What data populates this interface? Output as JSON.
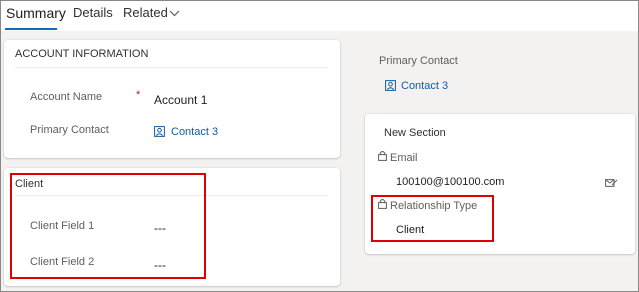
{
  "tabs": [
    {
      "label": "Summary"
    },
    {
      "label": "Details"
    },
    {
      "label": "Related"
    }
  ],
  "account_info": {
    "title": "ACCOUNT INFORMATION",
    "fields": [
      {
        "label": "Account Name",
        "required": "*",
        "value": "Account 1"
      },
      {
        "label": "Primary Contact",
        "value": "Contact 3"
      }
    ]
  },
  "client_section": {
    "title": "Client",
    "fields": [
      {
        "label": "Client Field 1",
        "value": "---"
      },
      {
        "label": "Client Field 2",
        "value": "---"
      }
    ]
  },
  "right_top": {
    "label": "Primary Contact",
    "value": "Contact 3"
  },
  "new_section": {
    "title": "New Section",
    "email_label": "Email",
    "email_value": "100100@100100.com",
    "relationship_label": "Relationship Type",
    "relationship_value": "Client"
  },
  "colors": {
    "accent": "#0f6cbd",
    "link": "#115ea3",
    "required": "#a4262c",
    "highlight": "#e00000"
  },
  "icons": [
    "chevron-down-icon",
    "contact-card-icon",
    "lock-icon",
    "email-compose-icon"
  ]
}
